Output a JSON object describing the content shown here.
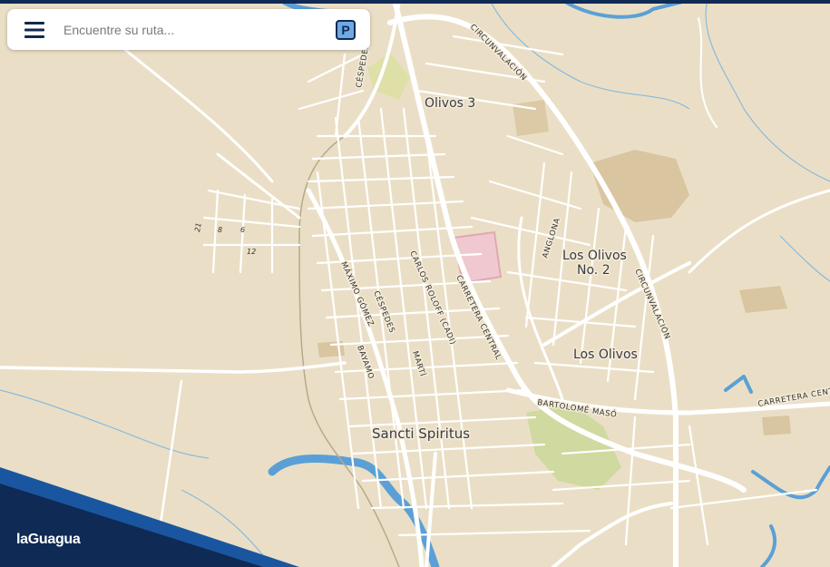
{
  "app": {
    "brand": "laGuagua"
  },
  "search": {
    "placeholder": "Encuentre su ruta..."
  },
  "parking_button": {
    "label": "P"
  },
  "colors": {
    "land": "#eadfc6",
    "road": "#ffffff",
    "water": "#5aa0d6",
    "park": "#cfd9a0",
    "built": "#d9c5a0",
    "brand_navy": "#0f2a55",
    "brand_blue": "#1a56a0"
  },
  "icons": {
    "menu": "hamburger-menu-icon",
    "parking": "parking-icon"
  },
  "map": {
    "places": [
      {
        "name": "Olivos 3"
      },
      {
        "name": "Los Olivos"
      },
      {
        "name": "No. 2"
      },
      {
        "name": "Los Olivos"
      },
      {
        "name": "Sancti Spiritus"
      }
    ],
    "streets": [
      "CÉSPEDES",
      "CIRCUNVALACIÓN",
      "ANGLONA",
      "CIRCUNVALACIÓN",
      "MÁXIMO GÓMEZ",
      "CÉSPEDES",
      "CARLOS ROLOFF (CADI)",
      "CARRETERA CENTRAL",
      "BAYAMO",
      "MARTÍ",
      "BARTOLOMÉ MASÓ",
      "CARRETERA CENTRAL"
    ],
    "block_numbers": [
      "21",
      "8",
      "6",
      "12"
    ]
  }
}
